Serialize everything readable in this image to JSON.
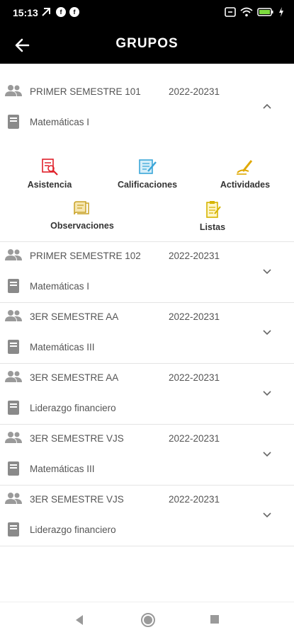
{
  "status": {
    "time": "15:13"
  },
  "appbar": {
    "title": "GRUPOS"
  },
  "expanded_group": {
    "name": "PRIMER SEMESTRE 101",
    "period": "2022-20231",
    "subject": "Matemáticas I",
    "actions": [
      {
        "label": "Asistencia",
        "icon": "attendance-icon",
        "color": "#e0202a"
      },
      {
        "label": "Calificaciones",
        "icon": "grades-icon",
        "color": "#3aa6d8"
      },
      {
        "label": "Actividades",
        "icon": "activities-icon",
        "color": "#e0a800"
      },
      {
        "label": "Observaciones",
        "icon": "observations-icon",
        "color": "#c9a227"
      },
      {
        "label": "Listas",
        "icon": "lists-icon",
        "color": "#d6b400"
      }
    ]
  },
  "groups": [
    {
      "name": "PRIMER SEMESTRE 102",
      "period": "2022-20231",
      "subject": "Matemáticas I"
    },
    {
      "name": "3ER SEMESTRE AA",
      "period": "2022-20231",
      "subject": "Matemáticas III"
    },
    {
      "name": "3ER SEMESTRE AA",
      "period": "2022-20231",
      "subject": "Liderazgo financiero"
    },
    {
      "name": "3ER SEMESTRE VJS",
      "period": "2022-20231",
      "subject": "Matemáticas III"
    },
    {
      "name": "3ER SEMESTRE VJS",
      "period": "2022-20231",
      "subject": "Liderazgo financiero"
    }
  ]
}
